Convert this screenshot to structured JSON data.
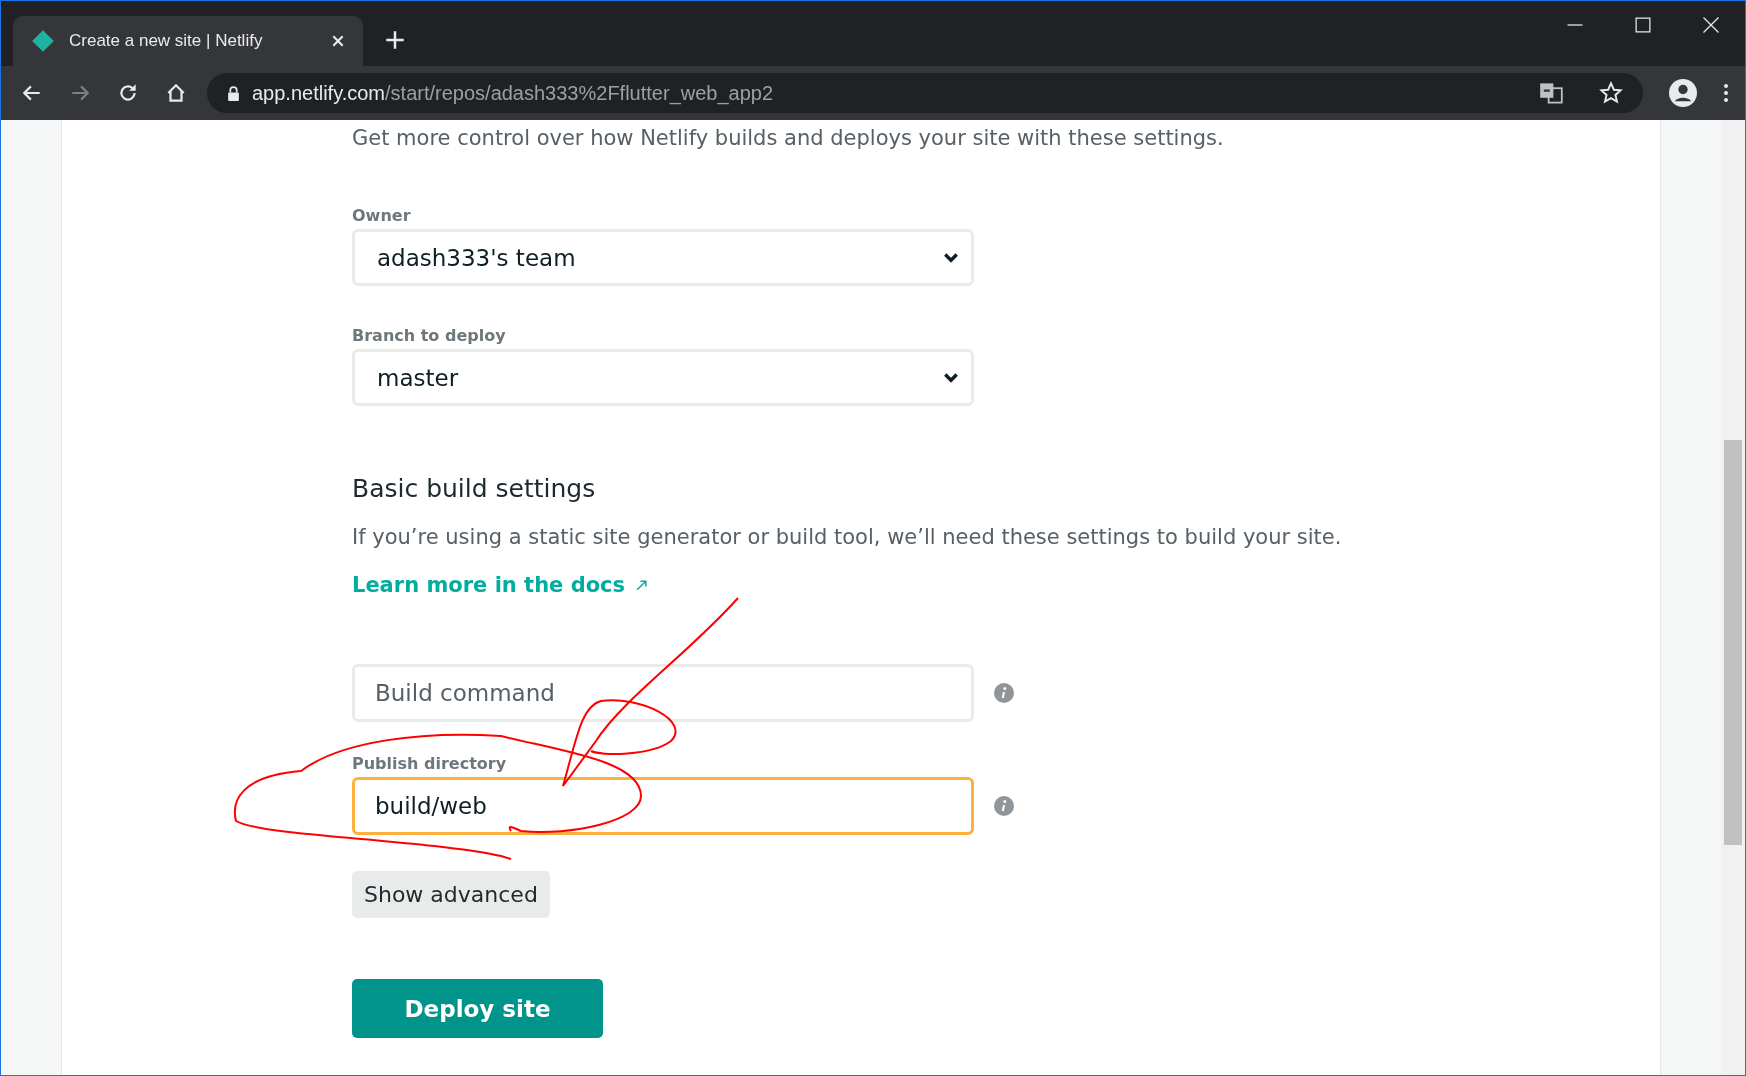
{
  "browser": {
    "tabs": [
      {
        "title": "Create a new site | Netlify",
        "selected": true
      }
    ],
    "url": {
      "host": "app.netlify.com",
      "path": "/start/repos/adash333%2Fflutter_web_app2"
    }
  },
  "page": {
    "intro": "Get more control over how Netlify builds and deploys your site with these settings.",
    "selects": [
      {
        "label": "Owner",
        "value": "adash333's team"
      },
      {
        "label": "Branch to deploy",
        "value": "master"
      }
    ],
    "section": {
      "heading": "Basic build settings",
      "description": "If you’re using a static site generator or build tool, we’ll need these settings to build your site.",
      "link": "Learn more in the docs"
    },
    "fields": [
      {
        "placeholder": "Build command",
        "focused": false
      },
      {
        "label": "Publish directory",
        "value": "build/web",
        "focused": true
      }
    ],
    "secondary_button": "Show advanced",
    "primary_button": "Deploy site"
  }
}
